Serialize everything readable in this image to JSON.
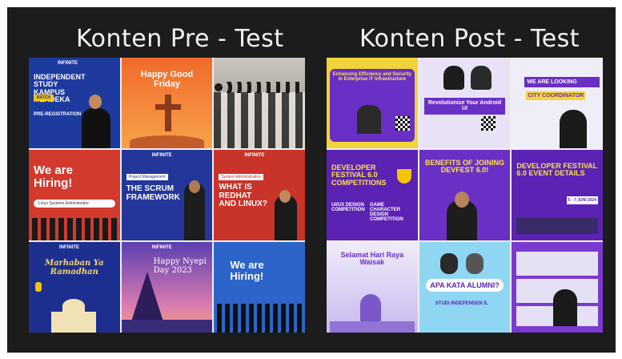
{
  "headings": {
    "pre": "Konten Pre - Test",
    "post": "Konten Post - Test"
  },
  "pre_tiles": {
    "t1": {
      "brand": "INFINITE",
      "title": "INDEPENDENT STUDY KAMPUS MERDEKA",
      "tag": "BATCH",
      "sub": "PRE-REGISTRATION"
    },
    "t2": {
      "title": "Happy Good Friday"
    },
    "t3": {},
    "t4": {
      "title": "We are Hiring!",
      "field": "Linux Systems Administrator"
    },
    "t5": {
      "brand": "INFINITE",
      "tag": "Project Management",
      "title": "THE SCRUM FRAMEWORK"
    },
    "t6": {
      "brand": "INFINITE",
      "tag": "System Administration",
      "title": "WHAT IS REDHAT AND LINUX?"
    },
    "t7": {
      "brand": "INFINITE",
      "title": "Marhaban Ya Ramadhan"
    },
    "t8": {
      "brand": "INFINITE",
      "title": "Happy Nyepi Day 2023"
    },
    "t9": {
      "title": "We are Hiring!"
    }
  },
  "post_tiles": {
    "p1": {
      "title": "Enhancing Efficiency and Security in Enterprise IT Infrastructure"
    },
    "p2": {
      "title": "Revolutionize Your Android UI"
    },
    "p3": {
      "title": "WE ARE LOOKING",
      "sub": "CITY COORDINATOR"
    },
    "p4": {
      "title": "DEVELOPER FESTIVAL 6.0 COMPETITIONS",
      "sub1": "UI/UX DESIGN COMPETITION",
      "sub2": "GAME CHARACTER DESIGN COMPETITION"
    },
    "p5": {
      "title": "BENEFITS OF JOINING DEVFEST 6.0!"
    },
    "p6": {
      "title": "DEVELOPER FESTIVAL 6.0 EVENT DETAILS",
      "date": "6 - 7 JUNI 2024"
    },
    "p7": {
      "title": "Selamat Hari Raya Waisak"
    },
    "p8": {
      "title": "APA KATA ALUMNI?",
      "sub": "STUDI INDEPENDEN IL"
    },
    "p9": {}
  }
}
